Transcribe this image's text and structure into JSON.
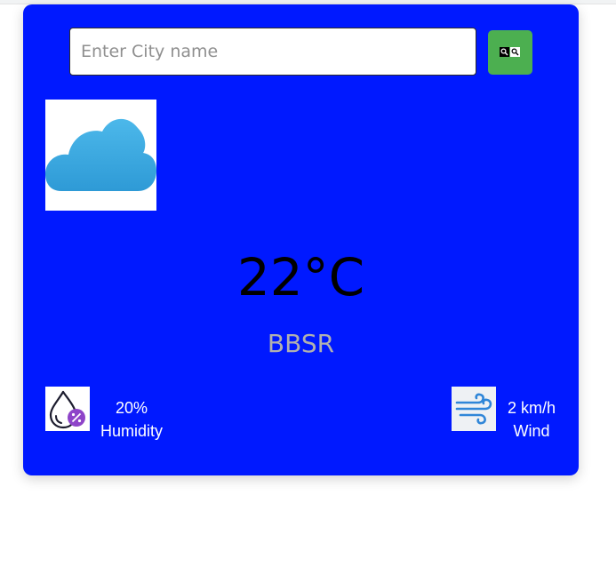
{
  "search": {
    "placeholder": "Enter City name",
    "value": ""
  },
  "weather": {
    "condition_icon": "cloud-icon",
    "temperature": "22°C",
    "city": "BBSR"
  },
  "humidity": {
    "value": "20%",
    "label": "Humidity",
    "icon": "humidity-drop-icon"
  },
  "wind": {
    "value": "2 km/h",
    "label": "Wind",
    "icon": "wind-icon"
  },
  "colors": {
    "card_background": "#0019ff",
    "search_button": "#4caf50",
    "city_text": "#b0b0b0",
    "stat_text": "#ffffff"
  }
}
